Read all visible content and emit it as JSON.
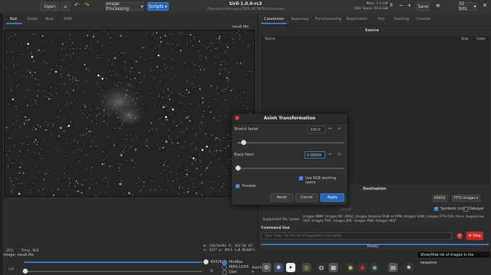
{
  "titlebar": {
    "title": "Siril-1.0.0-rc3",
    "path": "/home/cyril/Images/SIRIL/ACM/Tuto/process"
  },
  "toolbar": {
    "open_label": "Open",
    "image_processing_label": "Image Processing",
    "scripts_label": "Scripts",
    "mem_label": "Mem: 1.2 GiB",
    "disk_label": "Disk Space: 55.6 GiB",
    "threads_value": "8",
    "save_label": "Save",
    "bits_label": "32 bits"
  },
  "channel_tabs": [
    "Red",
    "Green",
    "Blue",
    "RGB"
  ],
  "image": {
    "filename": "result.fits"
  },
  "right_tabs": [
    "Conversion",
    "Sequence",
    "Pre-processing",
    "Registration",
    "Plot",
    "Stacking",
    "Console"
  ],
  "source_panel": {
    "title": "Source",
    "col_name": "Name",
    "col_size": "Size",
    "col_date": "Date"
  },
  "destination": {
    "title": "Destination",
    "index_value": "00001",
    "format_value": "FITS images",
    "cancel_label": "Cancel",
    "symbolic_link_label": "Symbolic Link",
    "debayer_label": "Debayer",
    "supported_label": "Supported file types:",
    "supported_text": "Images BMP, Images PIC (IRIS), Images binaires PGM et PPM, Images RAW, Images FITS-CFA, Films, Sequences SER, Images TIFF, Images JPG, Images PNG, Images HEIF"
  },
  "command": {
    "title": "Command line",
    "placeholder": "Type \"help\" for the list of supported commands",
    "stop_label": "Stop",
    "status": "Ready."
  },
  "image_info": {
    "zoom": "20%",
    "time": "Time: N/A",
    "coords_eq": "α: 23h23m46s  δ: +61°10'14\"",
    "coords_px": "x: 4177  y: 8921  (=0.063847)"
  },
  "bottom": {
    "image_label": "Image:",
    "image_name": "result.fits",
    "cut_label": "cut",
    "max_value": "65535",
    "min_value": "0",
    "mode_minmax": "MinMax",
    "mode_mips": "MIPS-LO/HI",
    "mode_user": "User",
    "stretch_label": "Asinh"
  },
  "dialog": {
    "title": "Asinh Transformation",
    "stretch_label": "Stretch factor",
    "stretch_value": "100.0",
    "stretch_fraction": 0.05,
    "black_label": "Black Point",
    "black_value": "0.00000",
    "black_fraction": 0.0,
    "rgb_label": "Use RGB working space",
    "preview_label": "Preview",
    "reset_label": "Reset",
    "cancel_label": "Cancel",
    "apply_label": "Apply"
  },
  "tooltip": {
    "text": "Show/Hide list of images in the sequence"
  }
}
